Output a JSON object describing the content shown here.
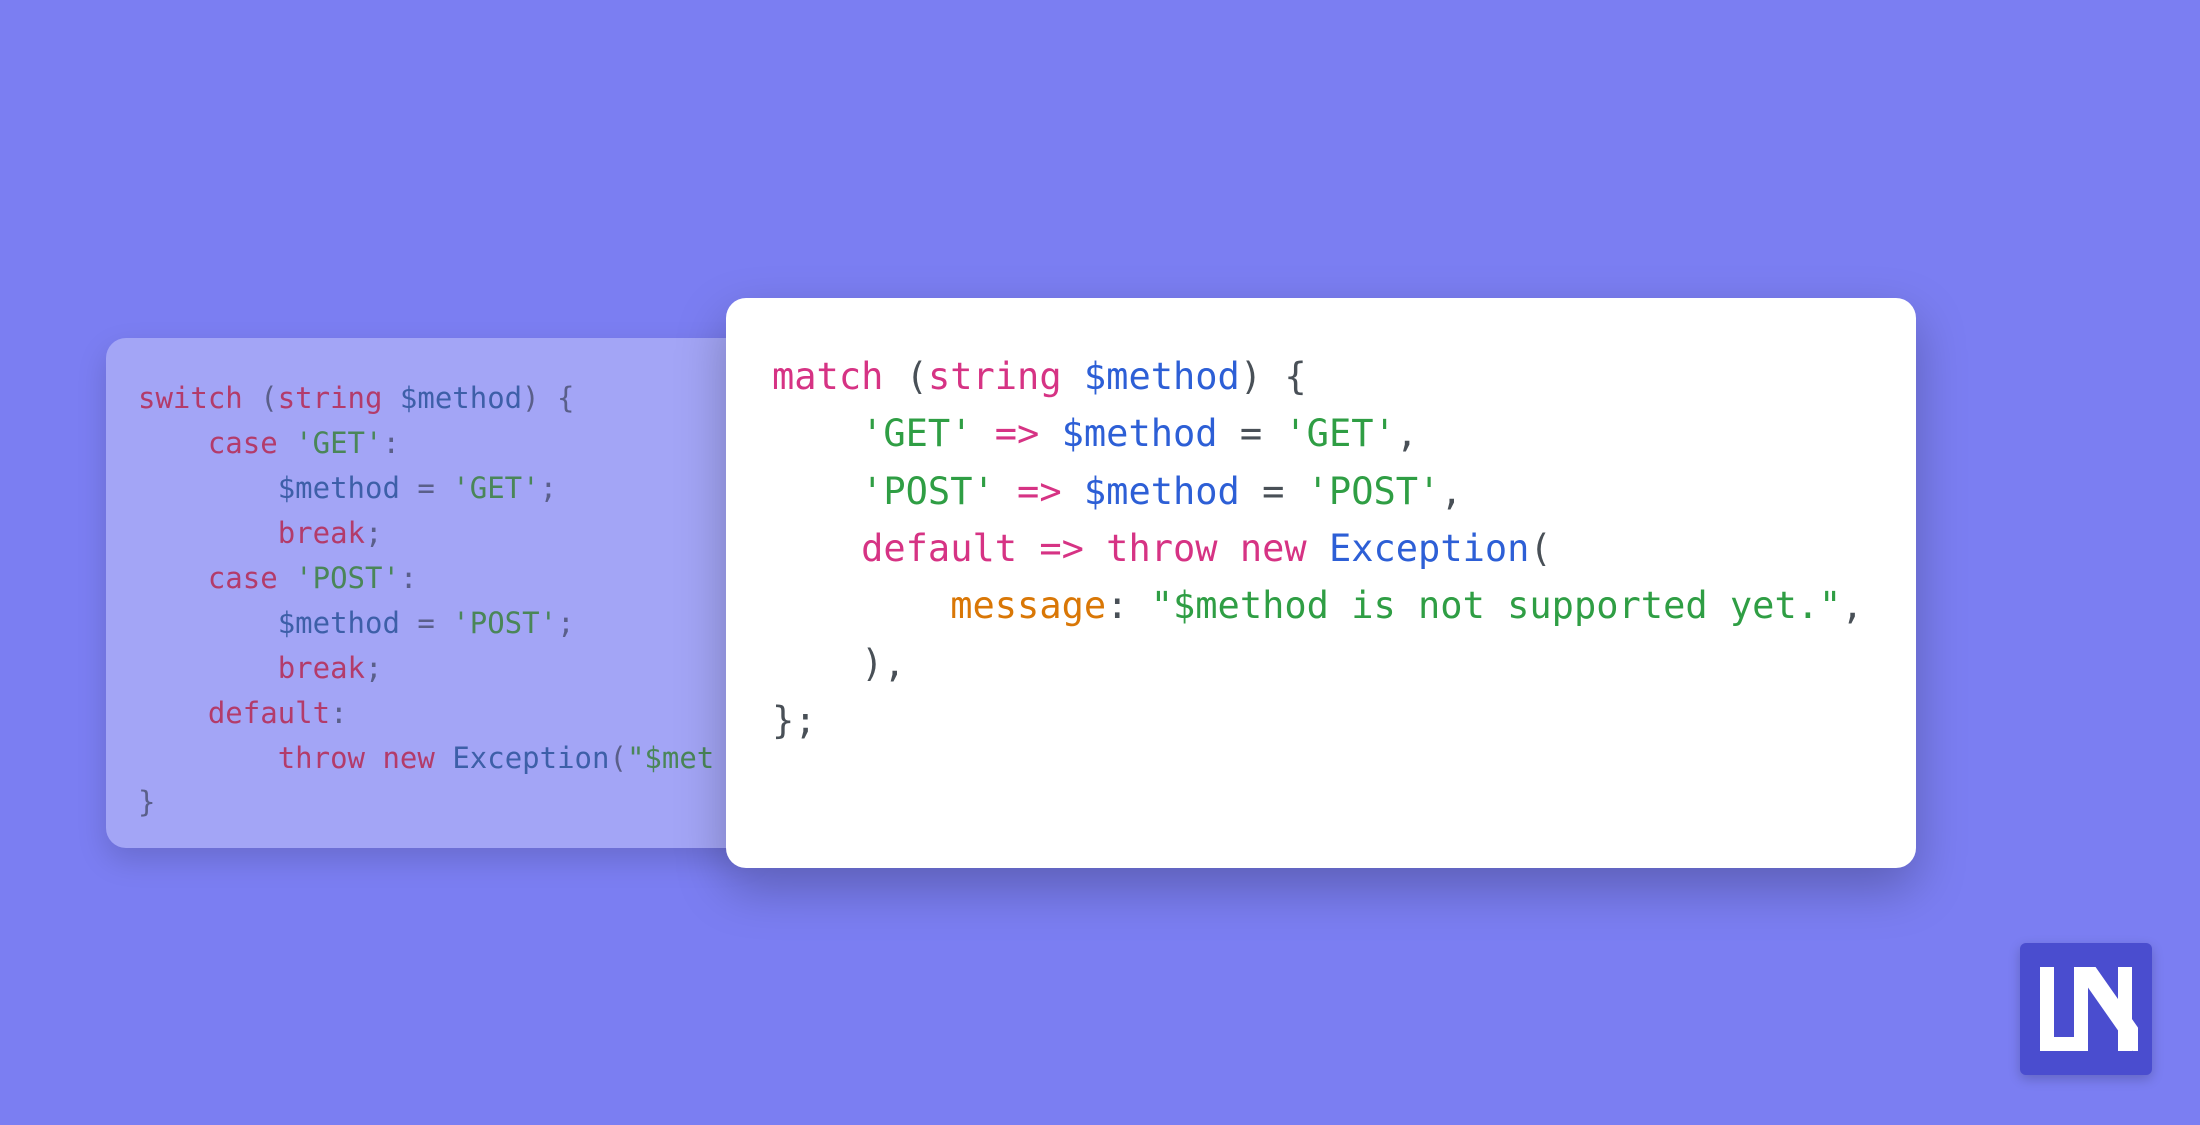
{
  "code_left": {
    "tokens": [
      [
        {
          "cls": "left-kw-red",
          "text": "switch"
        },
        {
          "cls": "left-punct",
          "text": " ("
        },
        {
          "cls": "left-kw-red",
          "text": "string"
        },
        {
          "cls": "left-punct",
          "text": " "
        },
        {
          "cls": "left-kw-blue",
          "text": "$method"
        },
        {
          "cls": "left-punct",
          "text": ") {"
        }
      ],
      [
        {
          "cls": "left-punct",
          "text": "    "
        },
        {
          "cls": "left-kw-red",
          "text": "case"
        },
        {
          "cls": "left-punct",
          "text": " "
        },
        {
          "cls": "left-kw-green",
          "text": "'GET'"
        },
        {
          "cls": "left-punct",
          "text": ":"
        }
      ],
      [
        {
          "cls": "left-punct",
          "text": "        "
        },
        {
          "cls": "left-kw-blue",
          "text": "$method"
        },
        {
          "cls": "left-punct",
          "text": " = "
        },
        {
          "cls": "left-kw-green",
          "text": "'GET'"
        },
        {
          "cls": "left-punct",
          "text": ";"
        }
      ],
      [
        {
          "cls": "left-punct",
          "text": "        "
        },
        {
          "cls": "left-kw-red",
          "text": "break"
        },
        {
          "cls": "left-punct",
          "text": ";"
        }
      ],
      [
        {
          "cls": "left-punct",
          "text": "    "
        },
        {
          "cls": "left-kw-red",
          "text": "case"
        },
        {
          "cls": "left-punct",
          "text": " "
        },
        {
          "cls": "left-kw-green",
          "text": "'POST'"
        },
        {
          "cls": "left-punct",
          "text": ":"
        }
      ],
      [
        {
          "cls": "left-punct",
          "text": "        "
        },
        {
          "cls": "left-kw-blue",
          "text": "$method"
        },
        {
          "cls": "left-punct",
          "text": " = "
        },
        {
          "cls": "left-kw-green",
          "text": "'POST'"
        },
        {
          "cls": "left-punct",
          "text": ";"
        }
      ],
      [
        {
          "cls": "left-punct",
          "text": "        "
        },
        {
          "cls": "left-kw-red",
          "text": "break"
        },
        {
          "cls": "left-punct",
          "text": ";"
        }
      ],
      [
        {
          "cls": "left-punct",
          "text": "    "
        },
        {
          "cls": "left-kw-red",
          "text": "default"
        },
        {
          "cls": "left-punct",
          "text": ":"
        }
      ],
      [
        {
          "cls": "left-punct",
          "text": "        "
        },
        {
          "cls": "left-kw-red",
          "text": "throw"
        },
        {
          "cls": "left-punct",
          "text": " "
        },
        {
          "cls": "left-kw-red",
          "text": "new"
        },
        {
          "cls": "left-punct",
          "text": " "
        },
        {
          "cls": "left-kw-blue",
          "text": "Exception"
        },
        {
          "cls": "left-punct",
          "text": "("
        },
        {
          "cls": "left-kw-green",
          "text": "\"$met"
        }
      ],
      [
        {
          "cls": "left-punct",
          "text": "}"
        }
      ]
    ]
  },
  "code_right": {
    "tokens": [
      [
        {
          "cls": "kw-red",
          "text": "match"
        },
        {
          "cls": "punct",
          "text": " ("
        },
        {
          "cls": "kw-red",
          "text": "string"
        },
        {
          "cls": "punct",
          "text": " "
        },
        {
          "cls": "kw-blue",
          "text": "$method"
        },
        {
          "cls": "punct",
          "text": ") {"
        }
      ],
      [
        {
          "cls": "punct",
          "text": "    "
        },
        {
          "cls": "kw-green",
          "text": "'GET'"
        },
        {
          "cls": "punct",
          "text": " "
        },
        {
          "cls": "kw-red",
          "text": "=>"
        },
        {
          "cls": "punct",
          "text": " "
        },
        {
          "cls": "kw-blue",
          "text": "$method"
        },
        {
          "cls": "punct",
          "text": " = "
        },
        {
          "cls": "kw-green",
          "text": "'GET'"
        },
        {
          "cls": "punct",
          "text": ","
        }
      ],
      [
        {
          "cls": "punct",
          "text": "    "
        },
        {
          "cls": "kw-green",
          "text": "'POST'"
        },
        {
          "cls": "punct",
          "text": " "
        },
        {
          "cls": "kw-red",
          "text": "=>"
        },
        {
          "cls": "punct",
          "text": " "
        },
        {
          "cls": "kw-blue",
          "text": "$method"
        },
        {
          "cls": "punct",
          "text": " = "
        },
        {
          "cls": "kw-green",
          "text": "'POST'"
        },
        {
          "cls": "punct",
          "text": ","
        }
      ],
      [
        {
          "cls": "punct",
          "text": "    "
        },
        {
          "cls": "kw-red",
          "text": "default"
        },
        {
          "cls": "punct",
          "text": " "
        },
        {
          "cls": "kw-red",
          "text": "=>"
        },
        {
          "cls": "punct",
          "text": " "
        },
        {
          "cls": "kw-red",
          "text": "throw"
        },
        {
          "cls": "punct",
          "text": " "
        },
        {
          "cls": "kw-red",
          "text": "new"
        },
        {
          "cls": "punct",
          "text": " "
        },
        {
          "cls": "kw-blue",
          "text": "Exception"
        },
        {
          "cls": "punct",
          "text": "("
        }
      ],
      [
        {
          "cls": "punct",
          "text": "        "
        },
        {
          "cls": "kw-orange",
          "text": "message"
        },
        {
          "cls": "punct",
          "text": ": "
        },
        {
          "cls": "kw-green",
          "text": "\"$method is not supported yet.\""
        },
        {
          "cls": "punct",
          "text": ","
        }
      ],
      [
        {
          "cls": "punct",
          "text": "    ),"
        }
      ],
      [
        {
          "cls": "punct",
          "text": "};"
        }
      ]
    ]
  },
  "logo_text": "LN"
}
